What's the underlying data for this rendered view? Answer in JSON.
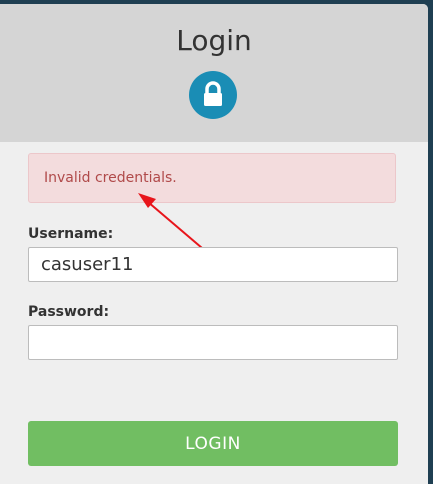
{
  "header": {
    "title": "Login",
    "icon": "lock-icon"
  },
  "alert": {
    "message": "Invalid credentials.",
    "annotation_icon": "red-arrow"
  },
  "form": {
    "username_label": "Username:",
    "username_value": "casuser11",
    "password_label": "Password:",
    "password_value": "",
    "login_label": "LOGIN"
  },
  "colors": {
    "background": "#1f3f52",
    "header": "#d5d5d5",
    "panel": "#efefef",
    "lock_circle": "#1a8db5",
    "alert_bg": "#f3dcdd",
    "alert_text": "#b04a4a",
    "login_button": "#71be62",
    "arrow": "#e8151b"
  }
}
